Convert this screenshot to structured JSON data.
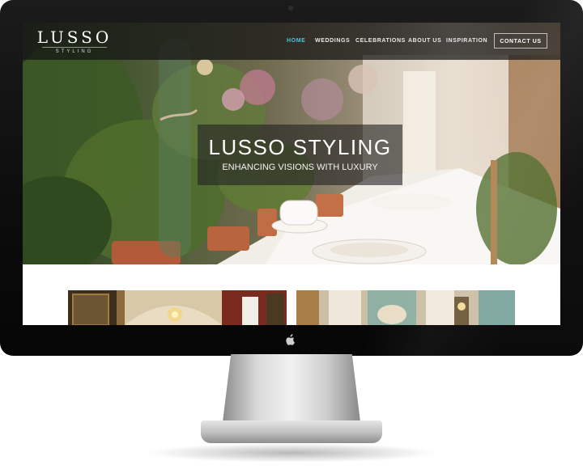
{
  "brand": {
    "name": "LUSSO",
    "subname": "STYLING"
  },
  "nav": {
    "items": [
      {
        "label": "HOME",
        "active": true
      },
      {
        "label": "WEDDINGS",
        "active": false
      },
      {
        "label": "CELEBRATIONS",
        "active": false
      },
      {
        "label": "ABOUT US",
        "active": false
      },
      {
        "label": "INSPIRATION",
        "active": false
      }
    ],
    "cta": "CONTACT US"
  },
  "hero": {
    "title": "LUSSO STYLING",
    "tagline": "ENHANCING VISIONS WITH LUXURY",
    "image": "table-setting-with-flowers"
  },
  "gallery": [
    {
      "image": "ornate-ballroom-with-chandelier"
    },
    {
      "image": "decorated-hall-with-candelabra"
    }
  ],
  "device": {
    "logo_icon": "apple-icon"
  },
  "colors": {
    "nav_active": "#4fc3d6",
    "nav_text": "#e8e8e8",
    "overlay": "#232323"
  }
}
